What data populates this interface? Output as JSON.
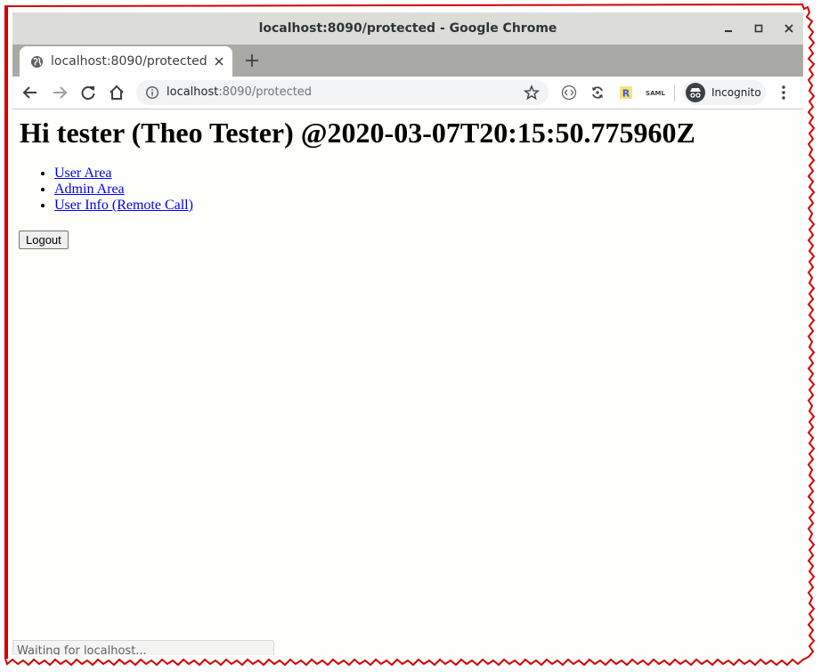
{
  "window": {
    "title": "localhost:8090/protected - Google Chrome"
  },
  "tab": {
    "label": "localhost:8090/protected"
  },
  "omnibox": {
    "host": "localhost",
    "path": ":8090/protected"
  },
  "incognito": {
    "label": "Incognito"
  },
  "page": {
    "heading": "Hi tester (Theo Tester) @2020-03-07T20:15:50.775960Z",
    "links": [
      "User Area",
      "Admin Area",
      "User Info (Remote Call)"
    ],
    "logout_label": "Logout"
  },
  "status": {
    "text": "Waiting for localhost..."
  },
  "colors": {
    "link": "#0000ee",
    "frame_border": "#d40000",
    "tabstrip": "#a9a9a6"
  },
  "icons": {
    "window_controls": [
      "minimize-icon",
      "maximize-icon",
      "close-icon"
    ],
    "toolbar": [
      "back-icon",
      "forward-icon",
      "reload-icon",
      "home-icon",
      "info-icon",
      "star-icon"
    ],
    "extensions": [
      "extension-code-icon",
      "extension-sync-icon",
      "extension-r-icon",
      "extension-saml-icon"
    ]
  }
}
